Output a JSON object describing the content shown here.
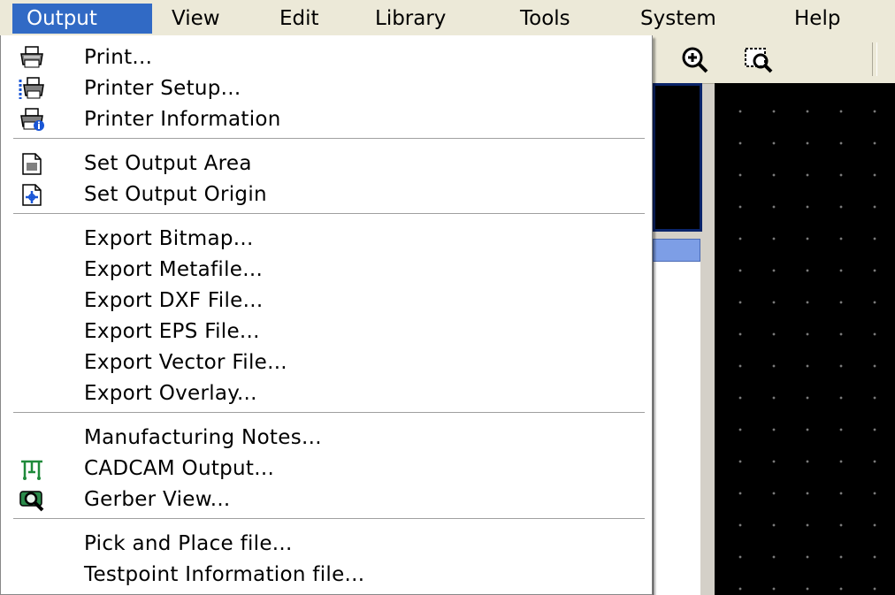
{
  "menubar": {
    "items": [
      {
        "label": "Output",
        "active": true
      },
      {
        "label": "View"
      },
      {
        "label": "Edit"
      },
      {
        "label": "Library"
      },
      {
        "label": "Tools"
      },
      {
        "label": "System"
      },
      {
        "label": "Help"
      }
    ]
  },
  "menu": {
    "items": [
      {
        "label": "Print...",
        "icon": "printer-icon"
      },
      {
        "label": "Printer Setup...",
        "icon": "printer-setup-icon"
      },
      {
        "label": "Printer Information",
        "icon": "printer-info-icon"
      },
      {
        "label": "Set Output Area",
        "icon": "output-area-icon"
      },
      {
        "label": "Set Output Origin",
        "icon": "output-origin-icon"
      },
      {
        "label": "Export Bitmap..."
      },
      {
        "label": "Export Metafile..."
      },
      {
        "label": "Export DXF File..."
      },
      {
        "label": "Export EPS File..."
      },
      {
        "label": "Export Vector File..."
      },
      {
        "label": "Export Overlay..."
      },
      {
        "label": "Manufacturing Notes..."
      },
      {
        "label": "CADCAM Output...",
        "icon": "cadcam-icon"
      },
      {
        "label": "Gerber View...",
        "icon": "gerber-view-icon"
      },
      {
        "label": "Pick and Place file..."
      },
      {
        "label": "Testpoint Information file..."
      }
    ]
  },
  "toolbar": {
    "icons": [
      "zoom-in-icon",
      "zoom-window-icon"
    ]
  },
  "colors": {
    "menu_highlight": "#316ac5",
    "menubar_bg": "#ece9d8",
    "workspace_bg": "#000000",
    "panel_border": "#0a246a"
  }
}
